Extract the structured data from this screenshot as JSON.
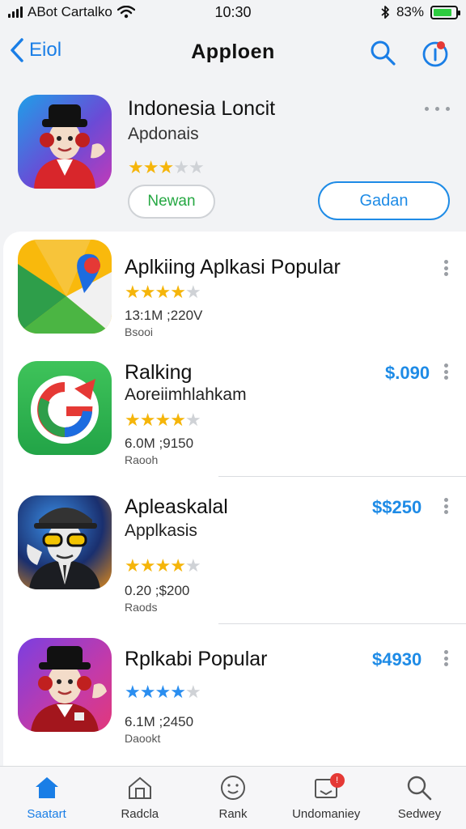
{
  "status_bar": {
    "carrier": "ABot Cartalko",
    "time": "10:30",
    "battery": "83%",
    "battery_level": 0.83
  },
  "nav": {
    "back_label": "Eiol",
    "title": "Apploen"
  },
  "featured": {
    "title": "Indonesia Loncit",
    "subtitle": "Apdonais",
    "rating": 3,
    "new_label": "Newan",
    "get_label": "Gadan"
  },
  "list": {
    "section_title": "Aplkiing Aplkasi Popular",
    "section_rating": 4,
    "section_stats": "13:1M ;220V",
    "section_label": "Bsooi",
    "items": [
      {
        "title": "Ralking",
        "subtitle": "Aoreiimhlahkam",
        "price": "$.090",
        "rating": 4,
        "stats": "6.0M ;9150",
        "label": "Raooh"
      },
      {
        "title": "Apleaskalal",
        "subtitle": "Applkasis",
        "price": "$$250",
        "rating": 4,
        "stats": "0.20 ;$200",
        "label": "Raods"
      },
      {
        "title": "Rplkabi Popular",
        "subtitle": "",
        "price": "$4930",
        "rating": 4,
        "stats": "6.1M ;2450",
        "label": "Daookt"
      }
    ]
  },
  "tabs": [
    {
      "label": "Saatart",
      "icon": "home-icon",
      "active": true
    },
    {
      "label": "Radcla",
      "icon": "apps-icon",
      "active": false
    },
    {
      "label": "Rank",
      "icon": "smiley-icon",
      "active": false
    },
    {
      "label": "Undomaniey",
      "icon": "updates-icon",
      "active": false,
      "badge": true
    },
    {
      "label": "Sedwey",
      "icon": "search-icon",
      "active": false
    }
  ],
  "colors": {
    "accent": "#1e8be6",
    "star": "#f5b50a",
    "badge": "#e53935",
    "new_green": "#26a843"
  }
}
